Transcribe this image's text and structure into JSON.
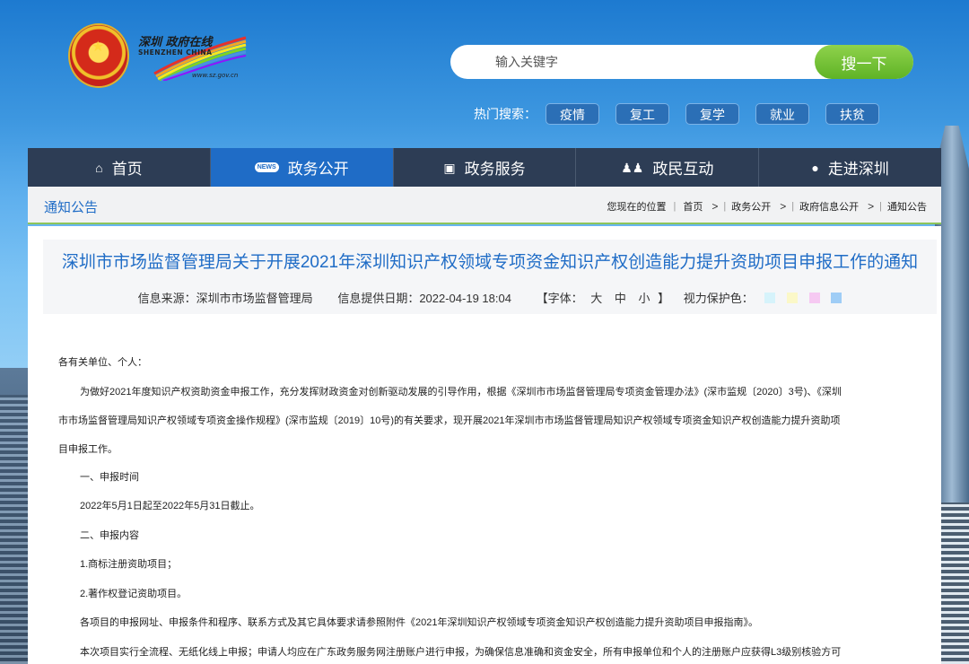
{
  "logo": {
    "cn": "深圳 政府在线",
    "en": "SHENZHEN CHINA",
    "url": "www.sz.gov.cn"
  },
  "search": {
    "placeholder": "输入关键字",
    "button": "搜一下"
  },
  "hot": {
    "label": "热门搜索：",
    "tags": [
      "疫情",
      "复工",
      "复学",
      "就业",
      "扶贫"
    ]
  },
  "nav": [
    {
      "label": "首页",
      "icon": "home-icon"
    },
    {
      "label": "政务公开",
      "icon": "news-icon"
    },
    {
      "label": "政务服务",
      "icon": "monitor-icon"
    },
    {
      "label": "政民互动",
      "icon": "people-icon"
    },
    {
      "label": "走进深圳",
      "icon": "info-icon"
    }
  ],
  "nav_news_badge": "NEWS",
  "breadcrumb": {
    "section": "通知公告",
    "prefix": "您现在的位置",
    "items": [
      "首页",
      "政务公开",
      "政府信息公开",
      "通知公告"
    ]
  },
  "article": {
    "title": "深圳市市场监督管理局关于开展2021年深圳知识产权领域专项资金知识产权创造能力提升资助项目申报工作的通知",
    "source": "信息来源：深圳市市场监督管理局",
    "date": "信息提供日期：2022-04-19 18:04",
    "font_label": "【字体：",
    "font_sizes": [
      "大",
      "中",
      "小"
    ],
    "font_end": "】",
    "eye_label": "视力保护色：",
    "swatches": [
      "#d6f3fb",
      "#fbf8c8",
      "#f6c9f2",
      "#9fcdf6"
    ],
    "paragraphs": [
      "各有关单位、个人：",
      "为做好2021年度知识产权资助资金申报工作，充分发挥财政资金对创新驱动发展的引导作用，根据《深圳市市场监督管理局专项资金管理办法》(深市监规〔2020〕3号)、《深圳",
      "市市场监督管理局知识产权领域专项资金操作规程》(深市监规〔2019〕10号)的有关要求，现开展2021年深圳市市场监督管理局知识产权领域专项资金知识产权创造能力提升资助项",
      "目申报工作。",
      "一、申报时间",
      "2022年5月1日起至2022年5月31日截止。",
      "二、申报内容",
      "1.商标注册资助项目；",
      "2.著作权登记资助项目。",
      "各项目的申报网址、申报条件和程序、联系方式及其它具体要求请参照附件《2021年深圳知识产权领域专项资金知识产权创造能力提升资助项目申报指南》。",
      "本次项目实行全流程、无纸化线上申报；申请人均应在广东政务服务网注册账户进行申报，为确保信息准确和资金安全，所有申报单位和个人的注册账户应获得L3级别核验方可"
    ]
  }
}
